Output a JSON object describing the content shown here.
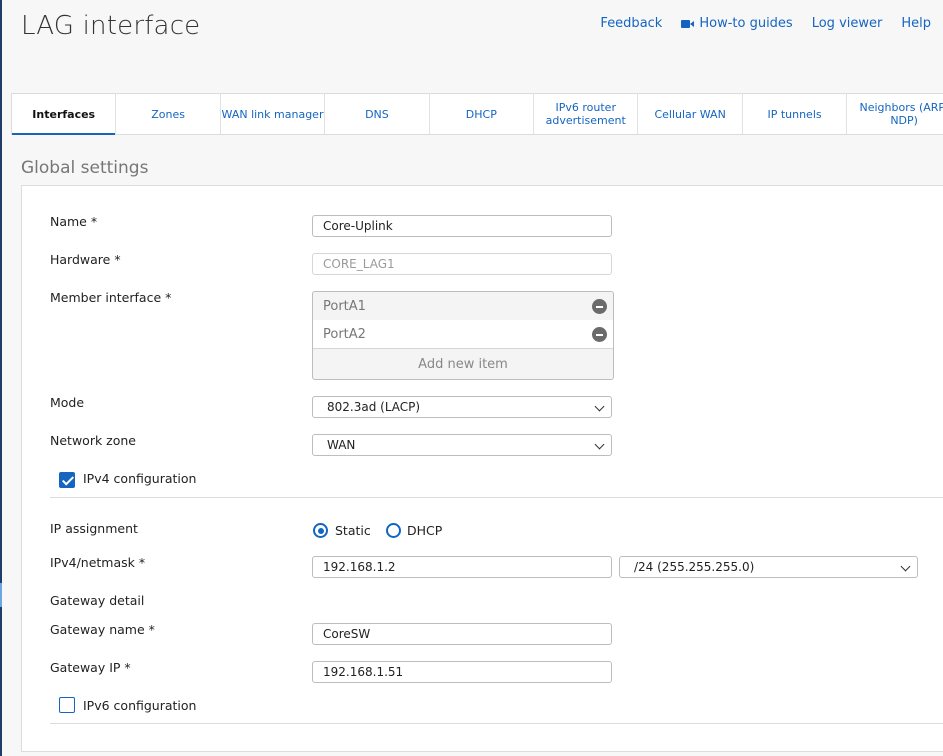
{
  "page": {
    "title": "LAG interface"
  },
  "top_links": {
    "feedback": "Feedback",
    "howto": "How-to guides",
    "logviewer": "Log viewer",
    "help": "Help"
  },
  "tabs": [
    {
      "label": "Interfaces",
      "active": true
    },
    {
      "label": "Zones"
    },
    {
      "label": "WAN link manager"
    },
    {
      "label": "DNS"
    },
    {
      "label": "DHCP"
    },
    {
      "label": "IPv6 router advertisement"
    },
    {
      "label": "Cellular WAN"
    },
    {
      "label": "IP tunnels"
    },
    {
      "label": "Neighbors (ARP-NDP)"
    }
  ],
  "section": {
    "title": "Global settings"
  },
  "form": {
    "name_label": "Name *",
    "name_value": "Core-Uplink",
    "hardware_label": "Hardware *",
    "hardware_value": "CORE_LAG1",
    "member_label": "Member interface *",
    "members": [
      "PortA1",
      "PortA2"
    ],
    "add_item": "Add new item",
    "mode_label": "Mode",
    "mode_value": "802.3ad (LACP)",
    "zone_label": "Network zone",
    "zone_value": "WAN",
    "ipv4_config_label": "IPv4 configuration",
    "ipv4_config_checked": true,
    "ip_assign_label": "IP assignment",
    "ip_assign_static": "Static",
    "ip_assign_dhcp": "DHCP",
    "ip_assign_selected": "Static",
    "ipv4_label": "IPv4/netmask *",
    "ipv4_value": "192.168.1.2",
    "netmask_value": "/24 (255.255.255.0)",
    "gateway_detail_label": "Gateway detail",
    "gateway_name_label": "Gateway name *",
    "gateway_name_value": "CoreSW",
    "gateway_ip_label": "Gateway IP *",
    "gateway_ip_value": "192.168.1.51",
    "ipv6_config_label": "IPv6 configuration",
    "ipv6_config_checked": false
  },
  "colors": {
    "accent": "#1565c0",
    "nav_edge": "#1f3d6b"
  }
}
